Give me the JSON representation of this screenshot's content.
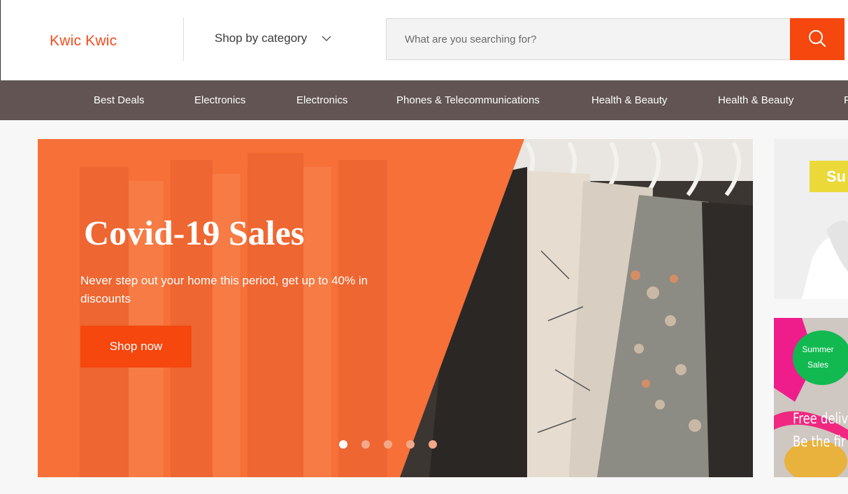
{
  "header": {
    "logo": "Kwic Kwic",
    "category_label": "Shop by category",
    "search_placeholder": "What are you searching for?",
    "search_icon": "search-icon",
    "chevron_icon": "chevron-down-icon"
  },
  "nav": {
    "items": [
      {
        "label": "Best Deals"
      },
      {
        "label": "Electronics"
      },
      {
        "label": "Electronics"
      },
      {
        "label": "Phones & Telecommunications"
      },
      {
        "label": "Health & Beauty"
      },
      {
        "label": "Health & Beauty"
      },
      {
        "label": "F"
      }
    ]
  },
  "hero": {
    "title": "Covid-19 Sales",
    "subtitle": "Never step out your home this period, get up to 40% in discounts",
    "button": "Shop now",
    "slide_count": 5,
    "active_slide": 1
  },
  "side_cards": {
    "top_badge": "Su",
    "summer_line1": "Summer",
    "summer_line2": "Sales",
    "promo_line1": "Free deliv",
    "promo_line2": "Be the fir"
  },
  "colors": {
    "accent": "#f5470e",
    "logo": "#f04e1e",
    "nav_bg": "#615453",
    "green_badge": "#11b950",
    "yellow_badge": "#ebd93a"
  }
}
